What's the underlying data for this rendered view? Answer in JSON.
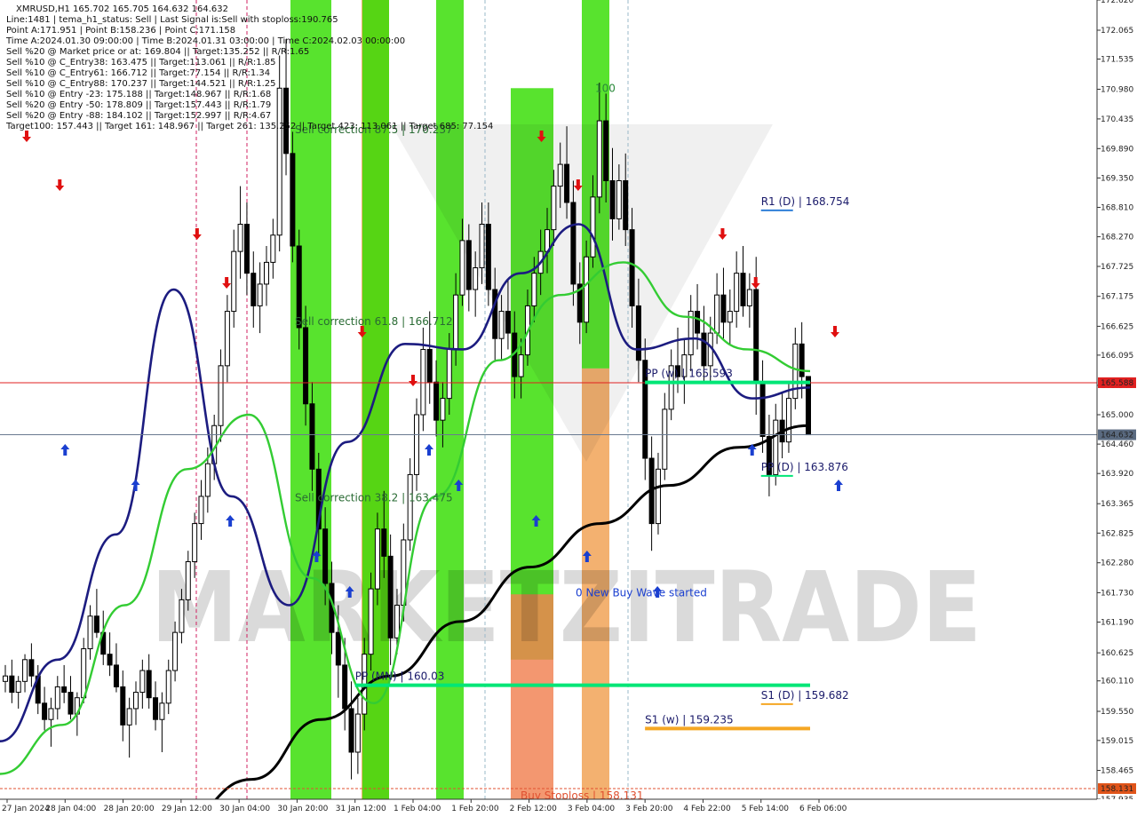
{
  "chart_data": {
    "type": "candlestick",
    "symbol": "XMRUSD,H1",
    "header_lines": [
      "XMRUSD,H1  165.702 165.705 164.632 164.632",
      "Line:1481 | tema_h1_status: Sell | Last Signal is:Sell with stoploss:190.765",
      "Point A:171.951 | Point B:158.236 | Point C:171.158",
      "Time A:2024.01.30 09:00:00 | Time B:2024.01.31 03:00:00 | Time C:2024.02.03 00:00:00",
      "Sell %20 @ Market price or at: 169.804 || Target:135.252 || R/R:1.65",
      "Sell %10 @ C_Entry38: 163.475 || Target:113.061 || R/R:1.85",
      "Sell %10 @ C_Entry61: 166.712 || Target:77.154 || R/R:1.34",
      "Sell %10 @ C_Entry88: 170.237 || Target:144.521 || R/R:1.25",
      "Sell %10 @ Entry -23: 175.188 || Target:148.967 || R/R:1.68",
      "Sell %20 @ Entry -50: 178.809 || Target:157.443 || R/R:1.79",
      "Sell %20 @ Entry -88: 184.102 || Target:152.997 || R/R:4.67",
      "Target100: 157.443 || Target 161: 148.967 || Target 261: 135.252 || Target 423: 113.061 || Target 685: 77.154"
    ],
    "watermark": "MARKETZITRADE",
    "y_axis": {
      "min": 157.935,
      "max": 172.62,
      "ticks": [
        "172.620",
        "172.065",
        "171.535",
        "170.980",
        "170.435",
        "169.890",
        "169.350",
        "168.810",
        "168.270",
        "167.725",
        "167.175",
        "166.625",
        "166.095",
        "165.540",
        "165.000",
        "164.460",
        "163.920",
        "163.365",
        "162.825",
        "162.280",
        "161.730",
        "161.190",
        "160.625",
        "160.110",
        "159.550",
        "159.015",
        "158.465",
        "157.935"
      ]
    },
    "x_axis_labels": [
      "27 Jan 2024",
      "28 Jan 04:00",
      "28 Jan 20:00",
      "29 Jan 12:00",
      "30 Jan 04:00",
      "30 Jan 20:00",
      "31 Jan 12:00",
      "1 Feb 04:00",
      "1 Feb 20:00",
      "2 Feb 12:00",
      "3 Feb 04:00",
      "3 Feb 20:00",
      "4 Feb 22:00",
      "5 Feb 14:00",
      "6 Feb 06:00"
    ],
    "x_range": [
      "27 Jan 2024",
      "6 Feb 06:00"
    ],
    "price_tags": [
      {
        "value": "165.588",
        "price": 165.588,
        "color": "#e02020"
      },
      {
        "value": "164.632",
        "price": 164.632,
        "color": "#5a6a80"
      },
      {
        "value": "158.131",
        "price": 158.131,
        "color": "#e0541a"
      }
    ],
    "horizontal_lines": [
      {
        "price": 165.588,
        "color": "#e02020",
        "label": ""
      },
      {
        "price": 164.632,
        "color": "#6a7a90",
        "label": ""
      },
      {
        "price": 158.131,
        "color": "#e05030",
        "label": "Buy Stoploss | 158.131"
      }
    ],
    "level_lines": [
      {
        "label": "R1 (D) | 168.754",
        "price": 168.754,
        "color": "#2f7fd8",
        "from": "5 Feb 14:00",
        "to": "6 Feb 06:00"
      },
      {
        "label": "PP (w) | 165.593",
        "price": 165.593,
        "color": "#00e676",
        "from": "3 Feb 20:00",
        "to": "6 Feb 06:00"
      },
      {
        "label": "PP (D) | 163.876",
        "price": 163.876,
        "color": "#00e676",
        "from": "5 Feb 14:00",
        "to": "6 Feb 06:00"
      },
      {
        "label": "PP (MN) | 160.03",
        "price": 160.03,
        "color": "#00e676",
        "from": "31 Jan 12:00",
        "to": "6 Feb 06:00"
      },
      {
        "label": "S1 (D) | 159.682",
        "price": 159.682,
        "color": "#f5a623",
        "from": "5 Feb 14:00",
        "to": "6 Feb 06:00"
      },
      {
        "label": "S1 (w) | 159.235",
        "price": 159.235,
        "color": "#f5a623",
        "from": "3 Feb 20:00",
        "to": "6 Feb 06:00"
      }
    ],
    "annotations": [
      {
        "text": "Sell correction 87.5 | 170.237",
        "price": 170.237,
        "color": "#2a6b34"
      },
      {
        "text": "Sell correction 61.8 | 166.712",
        "price": 166.712,
        "color": "#2a6b34"
      },
      {
        "text": "Sell correction 38.2 | 163.475",
        "price": 163.475,
        "color": "#2a6b34"
      },
      {
        "text": "0 New Buy Wave started",
        "price": 161.73,
        "color": "#1a3fd0"
      },
      {
        "text": "100",
        "price": 171.0,
        "color": "#2a8a3a"
      }
    ],
    "zones": [
      {
        "color": "#33dd00",
        "from_price": 157.935,
        "to_price": 172.62
      },
      {
        "color": "#f0a050",
        "from_price": 157.935,
        "to_price": 172.62
      },
      {
        "color": "#33dd00",
        "from_price": 157.935,
        "to_price": 172.62
      },
      {
        "color": "#33dd00",
        "from_price": 157.935,
        "to_price": 172.62
      },
      {
        "color": "#33dd00",
        "from_price": 160.5,
        "to_price": 171.0
      },
      {
        "color": "#f08050",
        "from_price": 157.935,
        "to_price": 161.7
      },
      {
        "color": "#33dd00",
        "from_price": 165.85,
        "to_price": 172.62
      },
      {
        "color": "#f0a050",
        "from_price": 157.935,
        "to_price": 165.85
      }
    ],
    "series": [
      {
        "name": "",
        "color": "#000000",
        "values": [
          157.6,
          158.3,
          159.4,
          160.2,
          161.2,
          162.2,
          163.0,
          163.7,
          164.4,
          164.8
        ]
      },
      {
        "name": "",
        "color": "#1c1c80",
        "values": [
          159.0,
          160.5,
          162.8,
          167.3,
          163.5,
          161.5,
          164.5,
          166.3,
          166.2,
          167.6,
          168.5,
          166.2,
          166.4,
          165.3,
          165.5
        ]
      },
      {
        "name": "",
        "color": "#33cc33",
        "values": [
          158.4,
          159.3,
          161.5,
          164.0,
          165.0,
          162.0,
          159.7,
          163.5,
          166.0,
          167.2,
          167.8,
          166.8,
          166.2,
          165.8
        ]
      }
    ],
    "candles": [
      [
        160.1,
        160.4,
        159.9,
        160.2
      ],
      [
        160.2,
        160.5,
        159.7,
        159.9
      ],
      [
        159.9,
        160.2,
        159.6,
        160.1
      ],
      [
        160.1,
        160.6,
        159.9,
        160.5
      ],
      [
        160.5,
        160.8,
        160.0,
        160.2
      ],
      [
        160.2,
        160.4,
        159.5,
        159.7
      ],
      [
        159.7,
        160.0,
        159.2,
        159.4
      ],
      [
        159.4,
        159.8,
        158.9,
        159.6
      ],
      [
        159.6,
        160.2,
        159.4,
        160.0
      ],
      [
        160.0,
        160.4,
        159.7,
        159.9
      ],
      [
        159.9,
        160.2,
        159.4,
        159.5
      ],
      [
        159.5,
        159.9,
        159.1,
        159.8
      ],
      [
        159.8,
        160.9,
        159.7,
        160.7
      ],
      [
        160.7,
        161.5,
        160.5,
        161.3
      ],
      [
        161.3,
        161.8,
        160.9,
        161.0
      ],
      [
        161.0,
        161.4,
        160.4,
        160.6
      ],
      [
        160.6,
        161.0,
        160.2,
        160.4
      ],
      [
        160.4,
        160.8,
        159.9,
        160.0
      ],
      [
        160.0,
        160.3,
        159.0,
        159.3
      ],
      [
        159.3,
        159.8,
        158.7,
        159.6
      ],
      [
        159.6,
        160.1,
        159.3,
        159.9
      ],
      [
        159.9,
        160.5,
        159.6,
        160.3
      ],
      [
        160.3,
        160.6,
        159.6,
        159.8
      ],
      [
        159.8,
        160.1,
        159.2,
        159.4
      ],
      [
        159.4,
        159.9,
        158.8,
        159.7
      ],
      [
        159.7,
        160.5,
        159.5,
        160.3
      ],
      [
        160.3,
        161.2,
        160.1,
        161.0
      ],
      [
        161.0,
        161.8,
        160.8,
        161.6
      ],
      [
        161.6,
        162.5,
        161.4,
        162.3
      ],
      [
        162.3,
        163.2,
        162.0,
        163.0
      ],
      [
        163.0,
        163.8,
        162.7,
        163.5
      ],
      [
        163.5,
        164.4,
        163.2,
        164.1
      ],
      [
        164.1,
        165.0,
        163.8,
        164.8
      ],
      [
        164.8,
        166.2,
        164.5,
        165.9
      ],
      [
        165.9,
        167.2,
        165.6,
        166.9
      ],
      [
        166.9,
        168.4,
        166.6,
        168.0
      ],
      [
        168.0,
        169.2,
        167.5,
        168.5
      ],
      [
        168.5,
        168.9,
        167.2,
        167.6
      ],
      [
        167.6,
        168.0,
        166.6,
        167.0
      ],
      [
        167.0,
        167.8,
        166.5,
        167.4
      ],
      [
        167.4,
        168.1,
        167.0,
        167.8
      ],
      [
        167.8,
        168.6,
        167.5,
        168.3
      ],
      [
        168.3,
        171.6,
        168.0,
        171.0
      ],
      [
        171.0,
        171.9,
        169.4,
        169.8
      ],
      [
        169.8,
        170.2,
        167.8,
        168.1
      ],
      [
        168.1,
        168.4,
        166.2,
        166.6
      ],
      [
        166.6,
        167.0,
        164.8,
        165.2
      ],
      [
        165.2,
        165.6,
        163.6,
        164.0
      ],
      [
        164.0,
        164.3,
        162.4,
        162.9
      ],
      [
        162.9,
        163.3,
        161.5,
        161.9
      ],
      [
        161.9,
        162.3,
        160.6,
        161.0
      ],
      [
        161.0,
        161.5,
        159.8,
        160.4
      ],
      [
        160.4,
        160.9,
        159.2,
        159.6
      ],
      [
        159.6,
        160.1,
        158.3,
        158.8
      ],
      [
        158.8,
        159.8,
        158.4,
        159.5
      ],
      [
        159.5,
        160.9,
        159.2,
        160.6
      ],
      [
        160.6,
        162.1,
        160.3,
        161.8
      ],
      [
        161.8,
        163.2,
        161.5,
        162.9
      ],
      [
        162.9,
        163.6,
        162.0,
        162.4
      ],
      [
        162.4,
        162.8,
        160.4,
        160.9
      ],
      [
        160.9,
        161.8,
        160.6,
        161.5
      ],
      [
        161.5,
        163.0,
        161.2,
        162.7
      ],
      [
        162.7,
        164.2,
        162.5,
        163.9
      ],
      [
        163.9,
        165.3,
        163.6,
        165.0
      ],
      [
        165.0,
        166.6,
        164.7,
        166.2
      ],
      [
        166.2,
        166.9,
        165.2,
        165.6
      ],
      [
        165.6,
        166.0,
        164.6,
        164.9
      ],
      [
        164.9,
        165.6,
        164.4,
        165.3
      ],
      [
        165.3,
        166.5,
        165.0,
        166.2
      ],
      [
        166.2,
        167.6,
        165.9,
        167.2
      ],
      [
        167.2,
        168.6,
        167.0,
        168.2
      ],
      [
        168.2,
        168.5,
        166.9,
        167.3
      ],
      [
        167.3,
        168.0,
        166.8,
        167.7
      ],
      [
        167.7,
        168.9,
        167.4,
        168.5
      ],
      [
        168.5,
        168.9,
        167.0,
        167.3
      ],
      [
        167.3,
        167.7,
        166.0,
        166.4
      ],
      [
        166.4,
        167.2,
        166.0,
        166.9
      ],
      [
        166.9,
        167.5,
        166.2,
        166.5
      ],
      [
        166.5,
        166.9,
        165.3,
        165.7
      ],
      [
        165.7,
        166.4,
        165.3,
        166.1
      ],
      [
        166.1,
        167.3,
        165.9,
        167.0
      ],
      [
        167.0,
        167.9,
        166.7,
        167.6
      ],
      [
        167.6,
        168.4,
        167.2,
        168.0
      ],
      [
        168.0,
        168.8,
        167.6,
        168.4
      ],
      [
        168.4,
        169.5,
        168.1,
        169.2
      ],
      [
        169.2,
        170.0,
        168.8,
        169.6
      ],
      [
        169.6,
        170.3,
        168.6,
        168.9
      ],
      [
        168.9,
        169.3,
        167.0,
        167.4
      ],
      [
        167.4,
        167.8,
        166.3,
        166.7
      ],
      [
        166.7,
        168.2,
        166.5,
        167.9
      ],
      [
        167.9,
        169.4,
        167.7,
        169.0
      ],
      [
        169.0,
        171.1,
        168.7,
        170.4
      ],
      [
        170.4,
        170.9,
        168.9,
        169.3
      ],
      [
        169.3,
        169.9,
        168.2,
        168.6
      ],
      [
        168.6,
        169.6,
        168.4,
        169.3
      ],
      [
        169.3,
        169.8,
        168.1,
        168.4
      ],
      [
        168.4,
        168.8,
        166.6,
        167.0
      ],
      [
        167.0,
        167.5,
        165.6,
        166.0
      ],
      [
        166.0,
        166.4,
        163.8,
        164.2
      ],
      [
        164.2,
        164.6,
        162.5,
        163.0
      ],
      [
        163.0,
        164.3,
        162.8,
        164.0
      ],
      [
        164.0,
        165.4,
        163.8,
        165.1
      ],
      [
        165.1,
        166.2,
        164.9,
        165.9
      ],
      [
        165.9,
        166.6,
        165.4,
        165.7
      ],
      [
        165.7,
        166.4,
        165.2,
        166.1
      ],
      [
        166.1,
        167.2,
        165.8,
        166.9
      ],
      [
        166.9,
        167.4,
        166.2,
        166.5
      ],
      [
        166.5,
        167.0,
        165.6,
        165.9
      ],
      [
        165.9,
        166.8,
        165.6,
        166.5
      ],
      [
        166.5,
        167.6,
        166.3,
        167.2
      ],
      [
        167.2,
        167.7,
        166.4,
        166.7
      ],
      [
        166.7,
        167.3,
        166.3,
        166.9
      ],
      [
        166.9,
        168.0,
        166.6,
        167.6
      ],
      [
        167.6,
        168.1,
        166.8,
        167.0
      ],
      [
        167.0,
        167.6,
        166.6,
        167.3
      ],
      [
        167.3,
        167.9,
        165.0,
        165.6
      ],
      [
        165.6,
        166.0,
        164.3,
        164.6
      ],
      [
        164.6,
        165.0,
        163.5,
        163.9
      ],
      [
        163.9,
        165.2,
        163.7,
        164.9
      ],
      [
        164.9,
        165.4,
        164.2,
        164.5
      ],
      [
        164.5,
        165.6,
        164.3,
        165.3
      ],
      [
        165.3,
        166.6,
        165.1,
        166.3
      ],
      [
        166.3,
        166.7,
        165.3,
        165.7
      ],
      [
        165.702,
        165.705,
        164.632,
        164.632
      ]
    ],
    "buy_signals": [
      "28 Jan 04:00",
      "28 Jan 20:00",
      "30 Jan 04:00",
      "30 Jan 20:00",
      "31 Jan 12:00",
      "1 Feb 04:00",
      "1 Feb 20:00",
      "2 Feb 12:00",
      "3 Feb 04:00",
      "3 Feb 20:00",
      "5 Feb 14:00",
      "6 Feb 06:00"
    ],
    "sell_signals": [
      "27 Jan 2024",
      "28 Jan 04:00",
      "29 Jan 12:00",
      "30 Jan 04:00",
      "31 Jan 12:00",
      "1 Feb 04:00",
      "2 Feb 12:00",
      "3 Feb 04:00",
      "4 Feb 22:00",
      "5 Feb 14:00",
      "6 Feb 06:00"
    ]
  }
}
